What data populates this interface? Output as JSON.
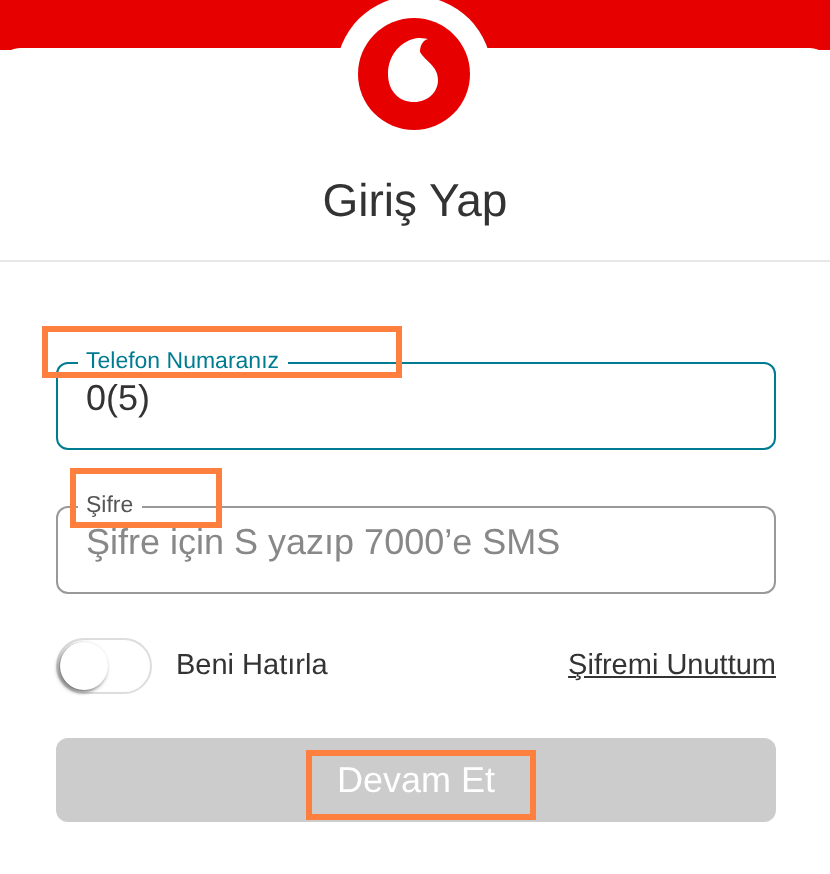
{
  "title": "Giriş Yap",
  "fields": [
    {
      "label": "Telefon Numaranız",
      "value": "0(5)",
      "focused": true,
      "highlighted": true
    },
    {
      "label": "Şifre",
      "placeholder": "Şifre için S yazıp 7000’e SMS",
      "focused": false,
      "highlighted": true
    }
  ],
  "remember": {
    "label": "Beni Hatırla",
    "on": false
  },
  "forgot_link": "Şifremi Unuttum",
  "submit": {
    "label": "Devam Et",
    "disabled": true,
    "highlighted": true
  }
}
